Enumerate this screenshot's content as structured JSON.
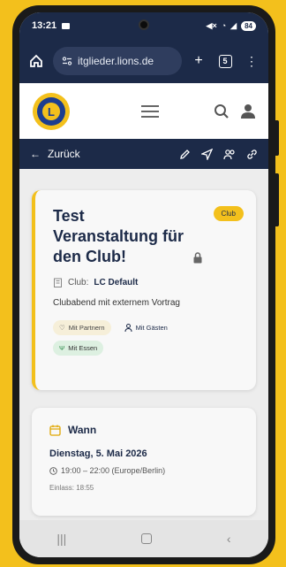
{
  "status": {
    "time": "13:21",
    "battery": "84"
  },
  "browser": {
    "url": "itglieder.lions.de",
    "tab_count": "5"
  },
  "nav": {
    "back_label": "Zurück"
  },
  "event": {
    "title": "Test Veranstaltung für den Club!",
    "badge": "Club",
    "club_prefix": "Club:",
    "club_name": "LC Default",
    "description": "Clubabend mit externem Vortrag",
    "chips": [
      "Mit Partnern",
      "Mit Gästen",
      "Mit Essen"
    ]
  },
  "when": {
    "heading": "Wann",
    "date": "Dienstag, 5. Mai 2026",
    "time": "19:00 – 22:00 (Europe/Berlin)",
    "einlass": "Einlass: 18:55"
  },
  "colors": {
    "navy": "#1c2a48",
    "gold": "#f3c01c",
    "essen_chip": "#ddf0e1",
    "partner_chip": "#f6efd9"
  },
  "icons": [
    "home-icon",
    "site-settings-icon",
    "plus-icon",
    "tabs-icon",
    "more-icon",
    "menu-icon",
    "search-icon",
    "user-icon",
    "back-arrow-icon",
    "edit-icon",
    "send-icon",
    "people-icon",
    "link-icon",
    "lock-icon",
    "building-icon",
    "heart-icon",
    "person-icon",
    "fork-knife-icon",
    "calendar-icon",
    "clock-icon"
  ]
}
